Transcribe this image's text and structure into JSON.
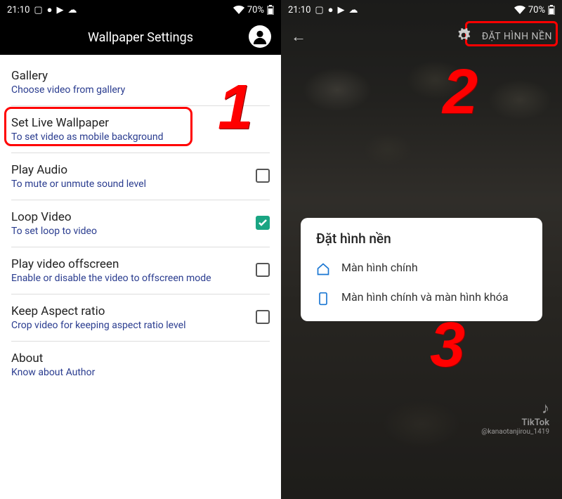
{
  "status": {
    "time": "21:10",
    "battery": "70%"
  },
  "phone1": {
    "title": "Wallpaper Settings",
    "items": [
      {
        "title": "Gallery",
        "sub": "Choose video from gallery",
        "checkbox": null
      },
      {
        "title": "Set Live Wallpaper",
        "sub": "To set video as mobile background",
        "checkbox": null
      },
      {
        "title": "Play Audio",
        "sub": "To mute or unmute sound level",
        "checkbox": false
      },
      {
        "title": "Loop Video",
        "sub": "To set loop to video",
        "checkbox": true
      },
      {
        "title": "Play video offscreen",
        "sub": "Enable or disable the video to offscreen mode",
        "checkbox": false
      },
      {
        "title": "Keep Aspect ratio",
        "sub": "Crop video for keeping aspect ratio level",
        "checkbox": false
      },
      {
        "title": "About",
        "sub": "Know about Author",
        "checkbox": null
      }
    ]
  },
  "phone2": {
    "setBtn": "ĐẶT HÌNH NỀN",
    "dialog": {
      "title": "Đặt hình nền",
      "options": [
        {
          "icon": "home",
          "text": "Màn hình chính"
        },
        {
          "icon": "phone",
          "text": "Màn hình chính và màn hình khóa"
        }
      ]
    },
    "tiktok": {
      "brand": "TikTok",
      "user": "@kanaotanjirou_1419"
    }
  },
  "steps": {
    "s1": "1",
    "s2": "2",
    "s3": "3"
  },
  "colors": {
    "highlight": "#f00",
    "link": "#2a3c8f",
    "checked": "#1aa583",
    "optIcon": "#1976d2"
  }
}
